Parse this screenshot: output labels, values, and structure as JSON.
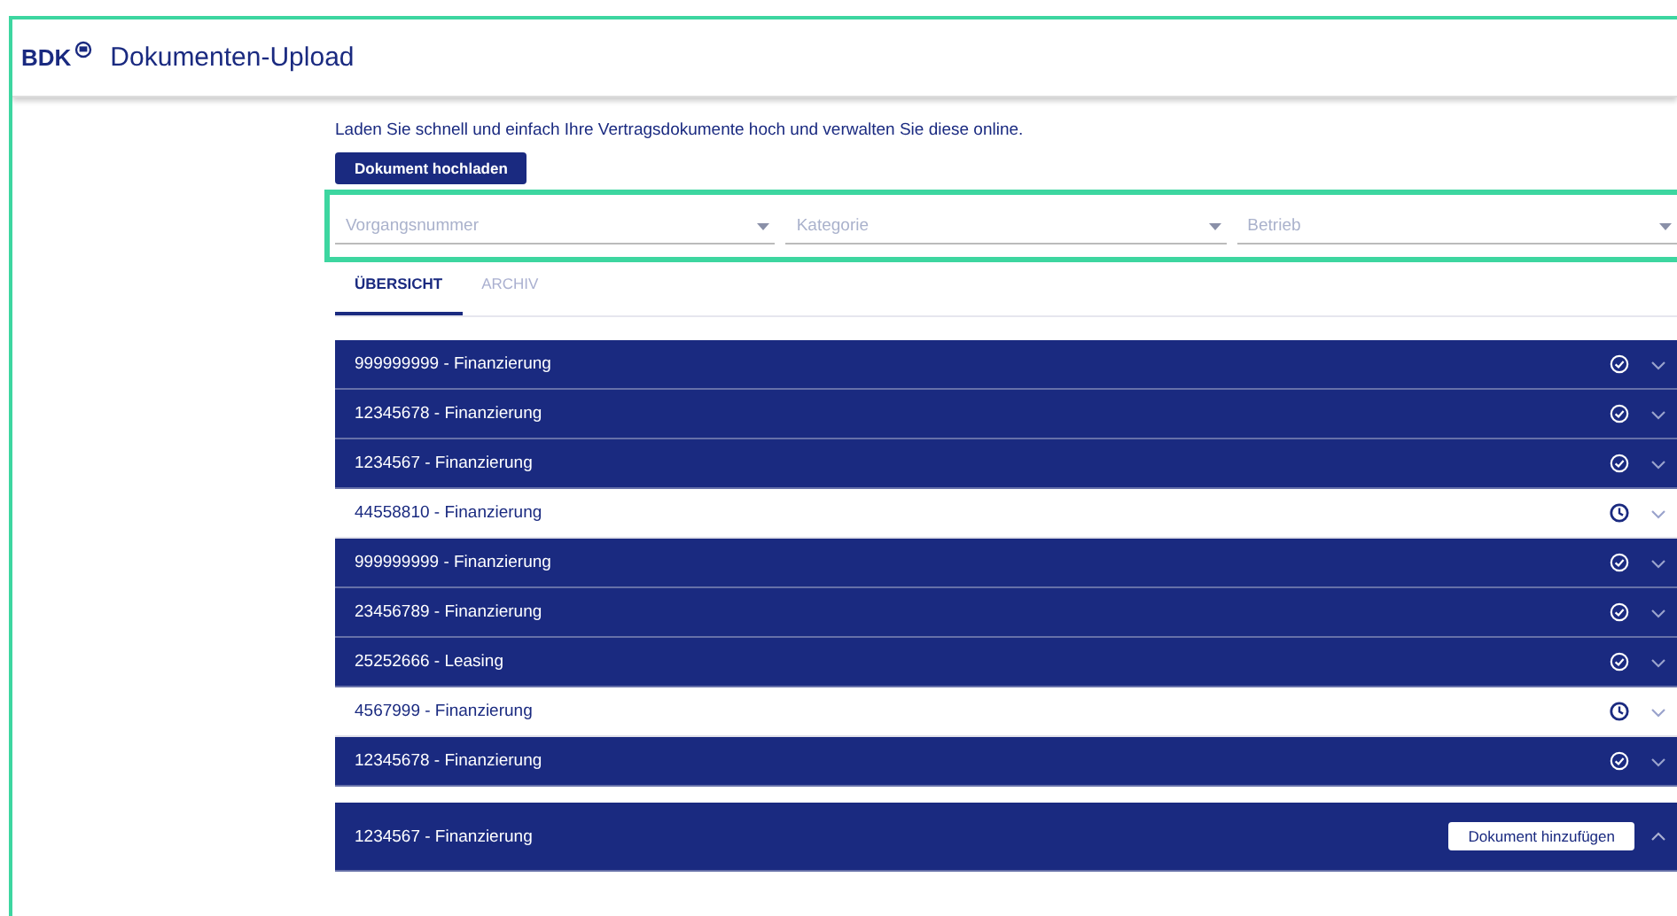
{
  "header": {
    "logo": "BDK",
    "title": "Dokumenten-Upload"
  },
  "intro": "Laden Sie schnell und einfach Ihre Vertragsdokumente hoch und verwalten Sie diese online.",
  "upload_button": "Dokument hochladen",
  "filters": [
    {
      "placeholder": "Vorgangsnummer"
    },
    {
      "placeholder": "Kategorie"
    },
    {
      "placeholder": "Betrieb"
    }
  ],
  "tabs": [
    {
      "label": "ÜBERSICHT",
      "selected": true
    },
    {
      "label": "ARCHIV",
      "selected": false
    }
  ],
  "rows": [
    {
      "label": "999999999 - Finanzierung",
      "kind": "done",
      "expanded": false
    },
    {
      "label": "12345678 - Finanzierung",
      "kind": "done",
      "expanded": false
    },
    {
      "label": "1234567 - Finanzierung",
      "kind": "done",
      "expanded": false
    },
    {
      "label": "44558810 - Finanzierung",
      "kind": "pending",
      "expanded": false
    },
    {
      "label": "999999999 - Finanzierung",
      "kind": "done",
      "expanded": false
    },
    {
      "label": "23456789 - Finanzierung",
      "kind": "done",
      "expanded": false
    },
    {
      "label": "25252666 - Leasing",
      "kind": "done",
      "expanded": false
    },
    {
      "label": "4567999 - Finanzierung",
      "kind": "pending",
      "expanded": false
    },
    {
      "label": "12345678 - Finanzierung",
      "kind": "done",
      "expanded": false
    },
    {
      "label": "1234567 - Finanzierung",
      "kind": "done",
      "expanded": true,
      "button": "Dokument hinzufügen"
    }
  ]
}
